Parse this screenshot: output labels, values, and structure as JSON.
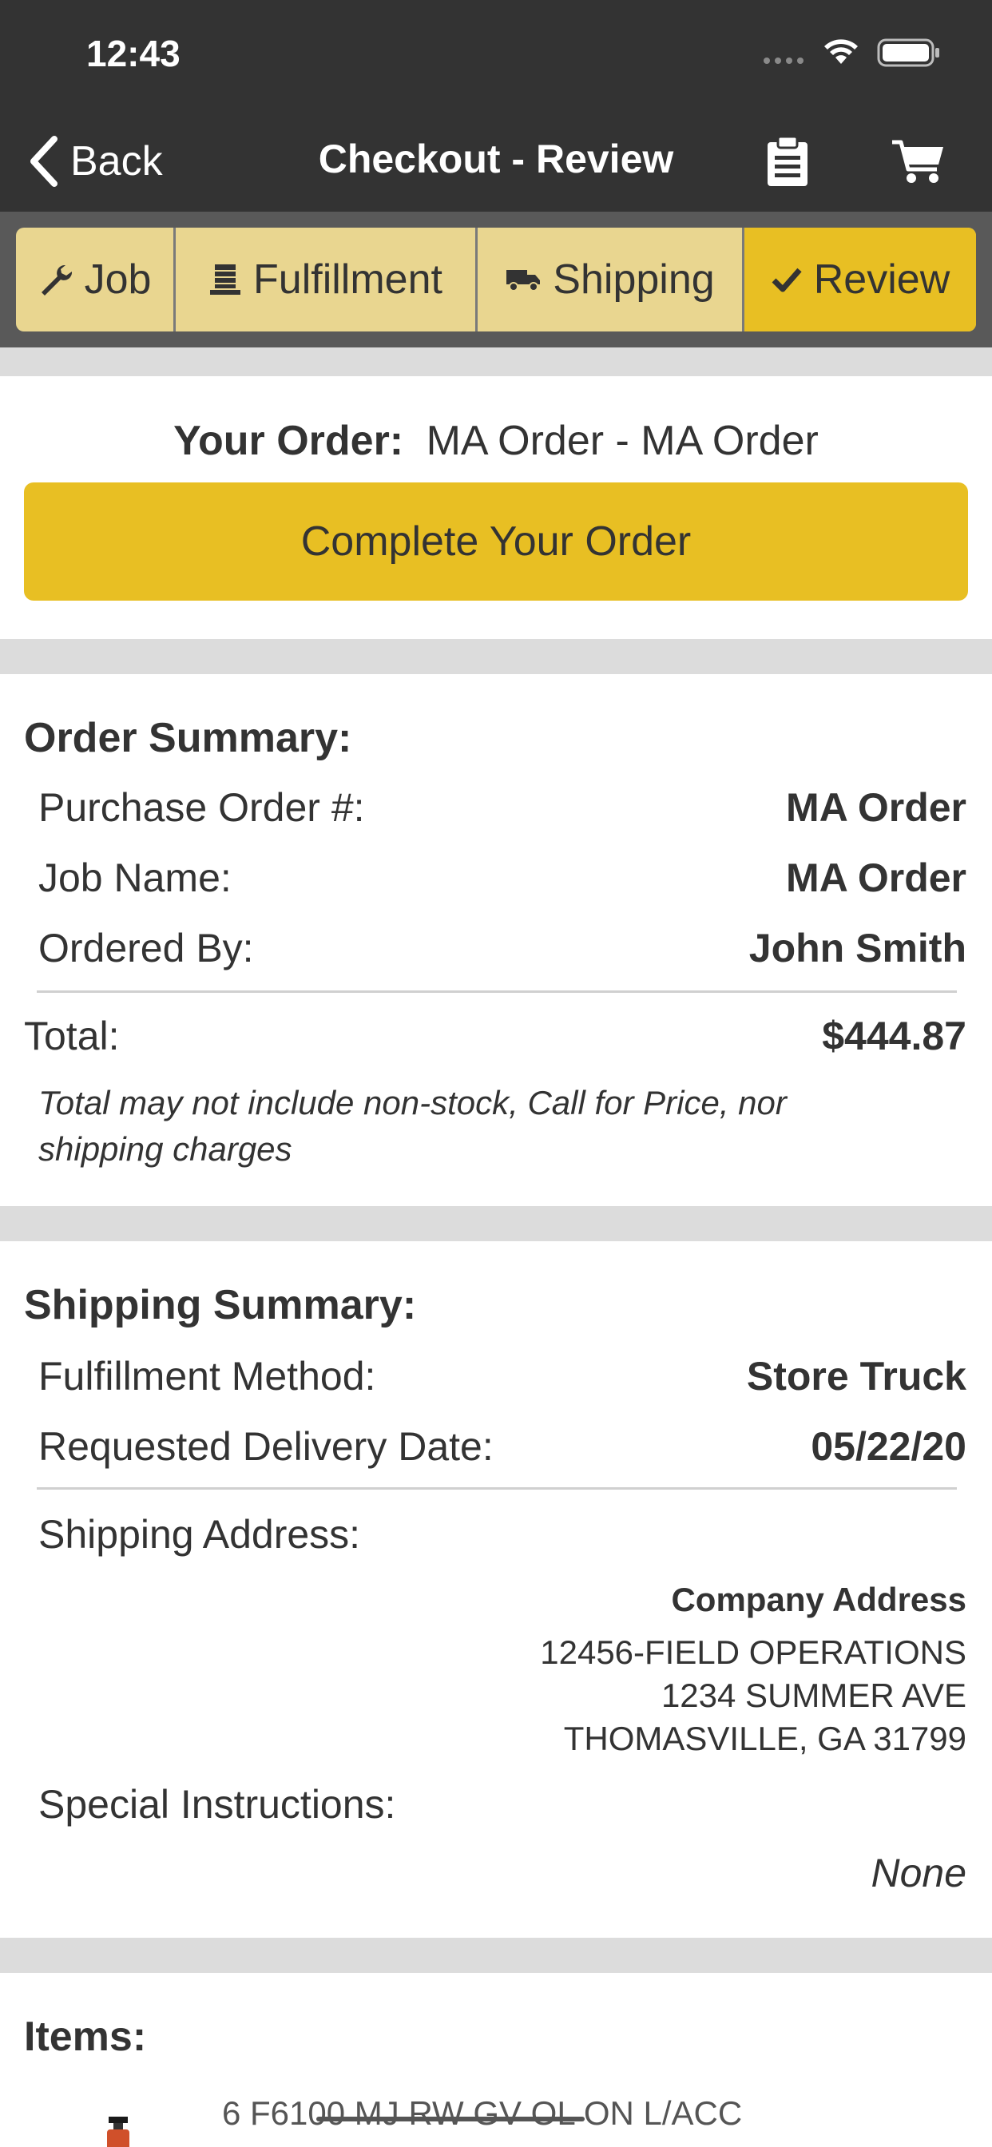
{
  "status_bar": {
    "time": "12:43"
  },
  "nav": {
    "back_label": "Back",
    "title": "Checkout - Review",
    "icons": [
      "clipboard-icon",
      "cart-icon"
    ]
  },
  "steps": [
    {
      "label": "Job",
      "icon": "wrench-icon",
      "active": false
    },
    {
      "label": "Fulfillment",
      "icon": "pallet-icon",
      "active": false
    },
    {
      "label": "Shipping",
      "icon": "truck-icon",
      "active": false
    },
    {
      "label": "Review",
      "icon": "checkmark-icon",
      "active": true
    }
  ],
  "order": {
    "label": "Your Order:",
    "value": "MA Order - MA Order",
    "complete_button": "Complete Your Order"
  },
  "order_summary": {
    "title": "Order Summary:",
    "po_label": "Purchase Order #:",
    "po_value": "MA Order",
    "job_label": "Job Name:",
    "job_value": "MA Order",
    "ordered_by_label": "Ordered By:",
    "ordered_by_value": "John Smith",
    "total_label": "Total:",
    "total_value": "$444.87",
    "note_line1": "Total may not include non-stock, Call for Price, nor",
    "note_line2": "shipping charges"
  },
  "shipping_summary": {
    "title": "Shipping Summary:",
    "method_label": "Fulfillment Method:",
    "method_value": "Store Truck",
    "date_label": "Requested Delivery Date:",
    "date_value": "05/22/20",
    "address_label": "Shipping Address:",
    "address_name": "Company Address",
    "address_line1": "12456-FIELD OPERATIONS",
    "address_line2": "1234 SUMMER AVE",
    "address_line3": "THOMASVILLE, GA 31799",
    "instructions_label": "Special Instructions:",
    "instructions_value": "None"
  },
  "items": {
    "title": "Items:",
    "first_item": "6 F6100 MJ RW GV OL ON L/ACC"
  },
  "colors": {
    "header_bg": "#333333",
    "tabbar_bg": "#595959",
    "tab_inactive": "#e9d690",
    "accent": "#e8bf23",
    "section_gap": "#dcdcdc"
  }
}
